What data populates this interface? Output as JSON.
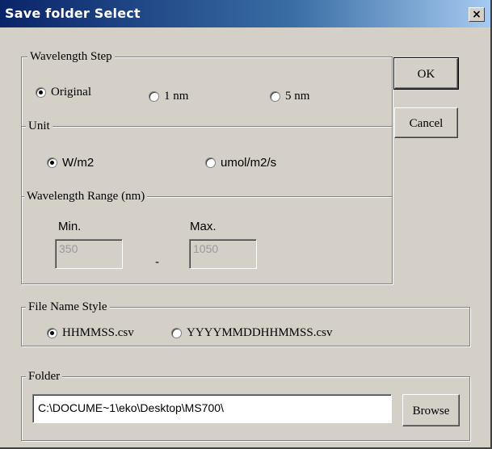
{
  "window": {
    "title": "Save folder Select",
    "close_glyph": "×"
  },
  "wavelength_step": {
    "legend": "Wavelength Step",
    "options": [
      {
        "label": "Original",
        "checked": true
      },
      {
        "label": "1 nm",
        "checked": false
      },
      {
        "label": "5 nm",
        "checked": false
      }
    ]
  },
  "unit": {
    "legend": "Unit",
    "options": [
      {
        "label": "W/m2",
        "checked": true
      },
      {
        "label": "umol/m2/s",
        "checked": false
      }
    ]
  },
  "wavelength_range": {
    "legend": "Wavelength Range (nm)",
    "min_label": "Min.",
    "min_value": "350",
    "separator": "-",
    "max_label": "Max.",
    "max_value": "1050"
  },
  "file_name_style": {
    "legend": "File Name Style",
    "options": [
      {
        "label": "HHMMSS.csv",
        "checked": true
      },
      {
        "label": "YYYYMMDDHHMMSS.csv",
        "checked": false
      }
    ]
  },
  "folder": {
    "legend": "Folder",
    "path": "C:\\DOCUME~1\\eko\\Desktop\\MS700\\",
    "browse_label": "Browse"
  },
  "buttons": {
    "ok_label": "OK",
    "cancel_label": "Cancel"
  }
}
